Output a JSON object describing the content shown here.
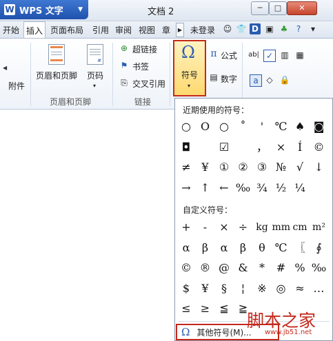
{
  "app": {
    "name": "WPS 文字",
    "logo": "W",
    "caret": "▼"
  },
  "window": {
    "title": "文档 2",
    "minimize": "─",
    "maximize": "□",
    "close": "✕"
  },
  "tabs": [
    {
      "label": "开始"
    },
    {
      "label": "插入"
    },
    {
      "label": "页面布局"
    },
    {
      "label": "引用"
    },
    {
      "label": "审阅"
    },
    {
      "label": "视图"
    },
    {
      "label": "章"
    }
  ],
  "toolbar_right": {
    "login": "未登录",
    "icons": [
      "user-icon",
      "shirt-icon",
      "d-icon",
      "photo-icon",
      "people-icon",
      "help-icon",
      "more-caret-icon"
    ]
  },
  "ribbon": {
    "attachment": "附件",
    "header_footer": "页眉和页脚",
    "page_number": "页码",
    "hyperlink": "超链接",
    "bookmark": "书签",
    "cross_ref": "交叉引用",
    "symbol": "符号",
    "formula": "公式",
    "number": "数字",
    "group_header_footer": "页眉和页脚",
    "group_link": "链接"
  },
  "panel": {
    "recent_title": "近期使用的符号：",
    "recent_symbols": [
      "○",
      "O",
      "○",
      "˚",
      "'",
      "℃",
      "♠",
      "◙",
      "◘",
      "",
      "☑",
      "",
      "，",
      "×",
      "Í",
      "©",
      "≠",
      "¥",
      "①",
      "②",
      "③",
      "№",
      "√",
      "↓",
      "→",
      "↑",
      "←",
      "‰",
      "¾",
      "½",
      "¼",
      ""
    ],
    "custom_title": "自定义符号：",
    "custom_symbols": [
      "+",
      "-",
      "×",
      "÷",
      "kg",
      "mm",
      "cm",
      "m²",
      "α",
      "β",
      "α",
      "β",
      "θ",
      "℃",
      "〖",
      "∮",
      "©",
      "®",
      "@",
      "&",
      "*",
      "#",
      "%",
      "‰",
      "$",
      "¥",
      "§",
      "¦",
      "※",
      "◎",
      "≈",
      "…",
      "≤",
      "≥",
      "≦",
      "≧",
      "",
      "",
      "",
      ""
    ],
    "more_label": "其他符号(M)..."
  },
  "watermark": {
    "text": "脚本之家",
    "url": "www.jb51.net"
  }
}
